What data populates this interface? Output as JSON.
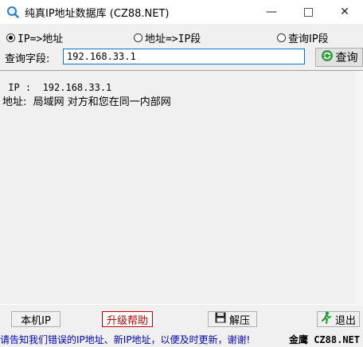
{
  "window": {
    "title": "纯真IP地址数据库  (CZ88.NET)",
    "controls": [
      "minimize",
      "maximize",
      "close"
    ]
  },
  "mode_options": [
    {
      "label": "IP=>地址",
      "checked": true
    },
    {
      "label": "地址=>IP段",
      "checked": false
    },
    {
      "label": "查询IP段",
      "checked": false
    }
  ],
  "query": {
    "label": "查询字段:",
    "value": "192.168.33.1",
    "button_label": "查询"
  },
  "result": {
    "ip_line": " IP :  192.168.33.1",
    "address_line": "地址:  局域网 对方和您在同一内部网"
  },
  "buttons": {
    "local_ip": "本机IP",
    "upgrade_help": "升级帮助",
    "unzip": "解压",
    "exit": "退出"
  },
  "status_bar": {
    "marquee": "请告知我们错误的IP地址、新IP地址，以便及时更新，谢谢!",
    "brand": "金鹰 CZ88.NET"
  },
  "colors": {
    "accent": "#0078d7",
    "help_red": "#c00000",
    "marquee_blue": "#0000cc"
  },
  "icons": {
    "app": "magnifier-app-icon",
    "query": "refresh-icon",
    "unzip": "floppy-disk-icon",
    "exit": "running-man-icon"
  }
}
